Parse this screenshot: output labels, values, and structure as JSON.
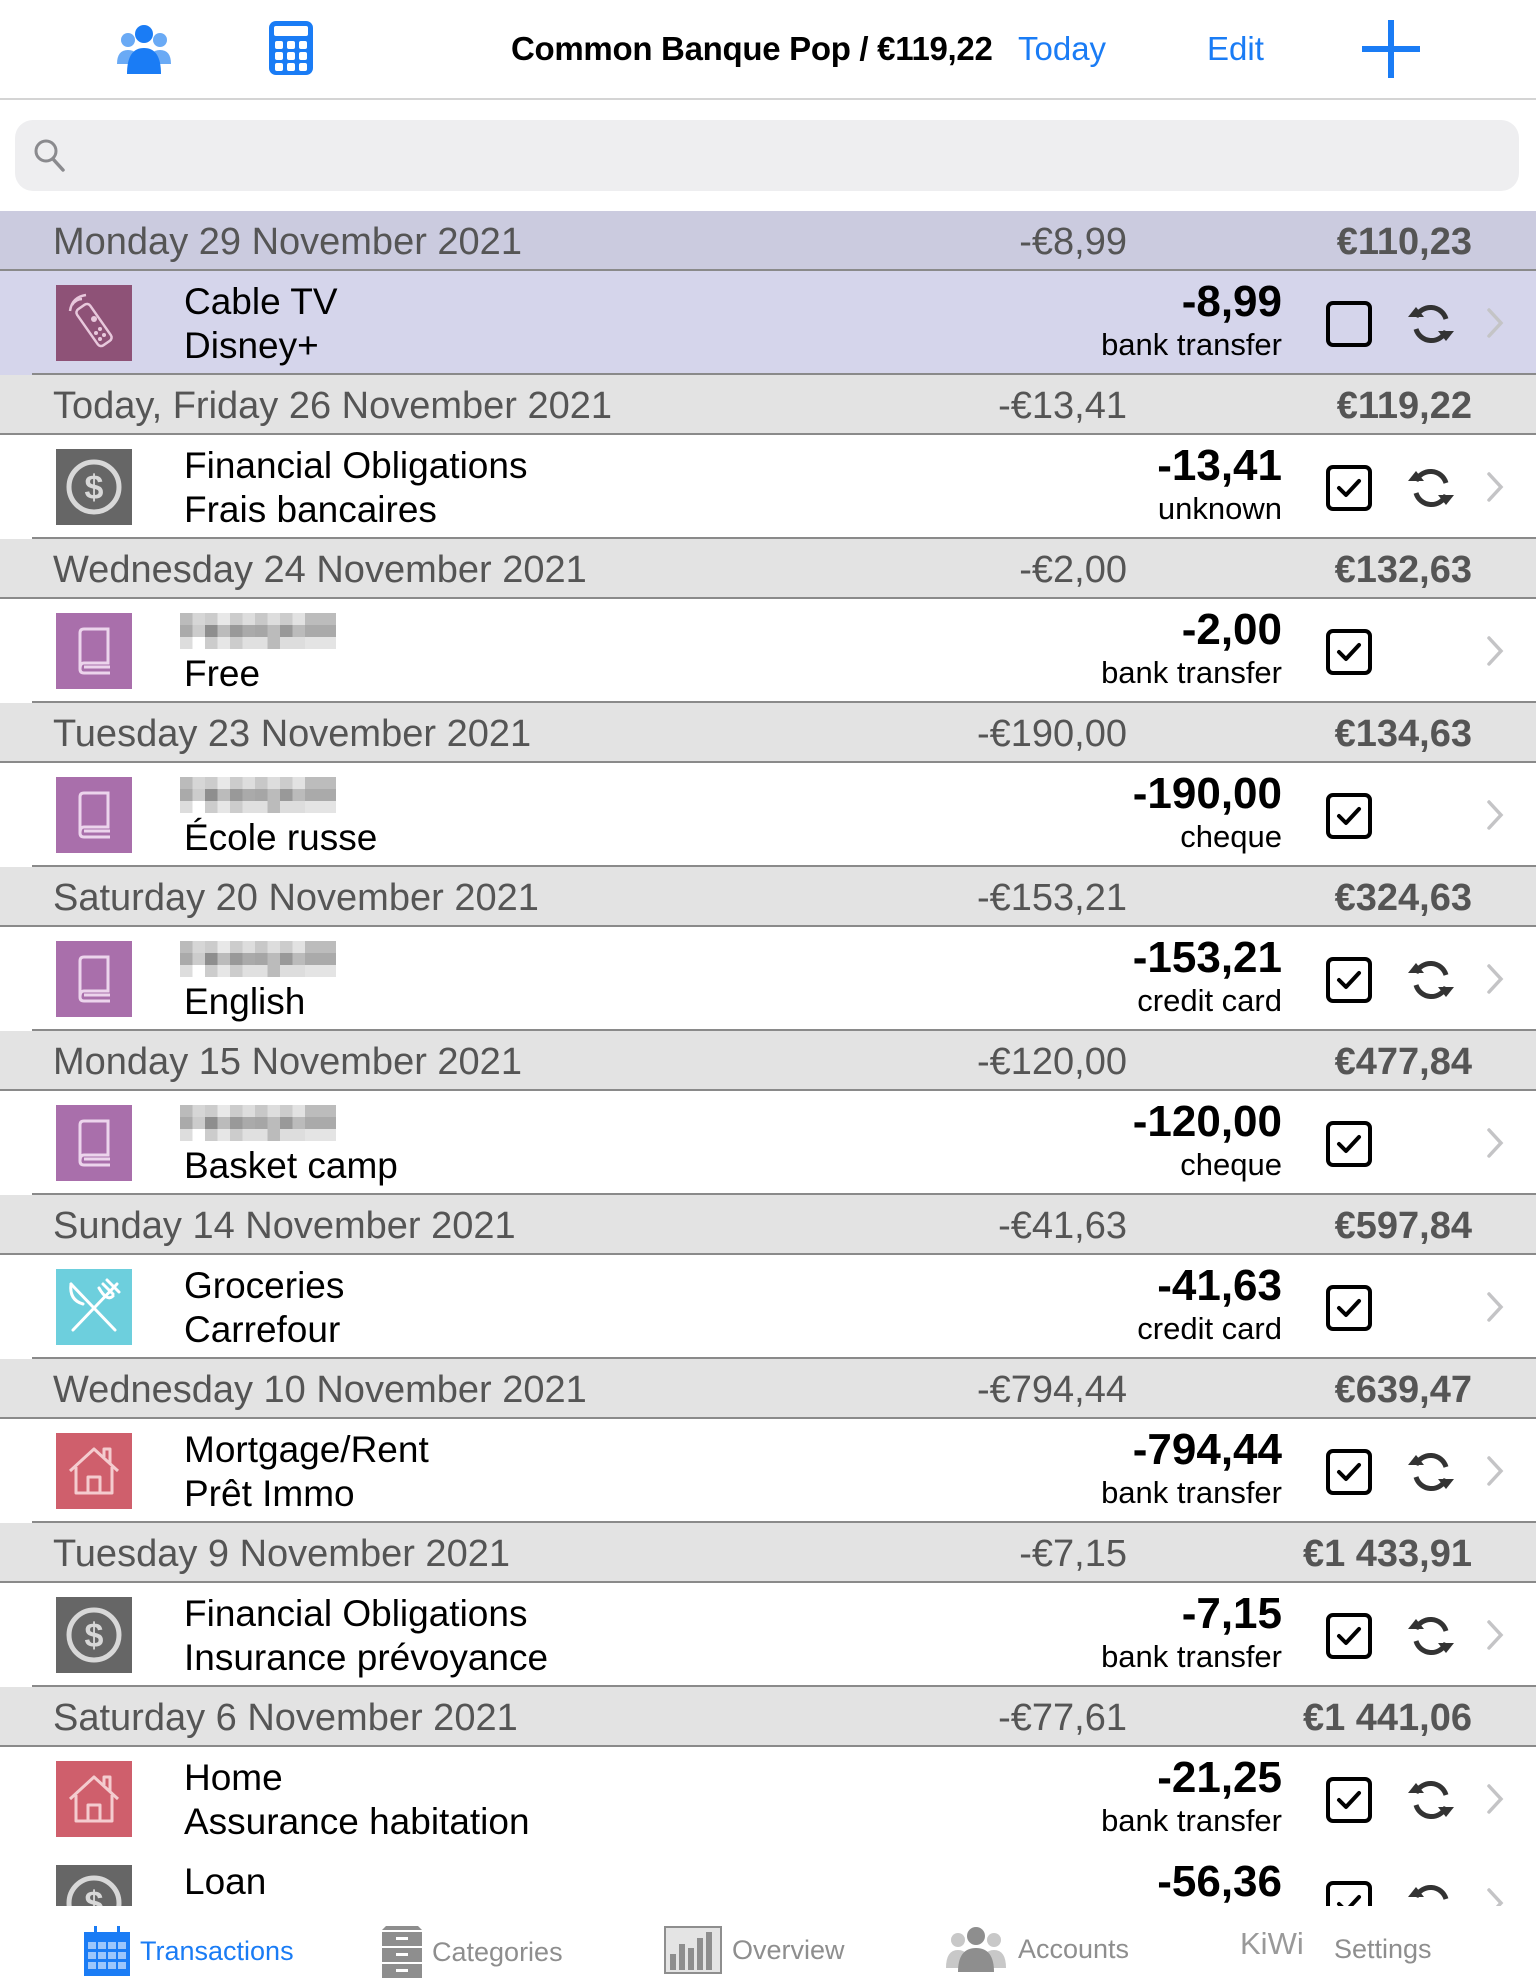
{
  "header": {
    "title": "Common Banque Pop / €119,22",
    "today_label": "Today",
    "edit_label": "Edit",
    "accent_color": "#1a7cf5"
  },
  "search": {
    "placeholder": ""
  },
  "sections": [
    {
      "date": "Monday 29 November 2021",
      "total": "-€8,99",
      "balance": "€110,23",
      "highlighted": true,
      "rows": [
        {
          "icon": "remote-control-icon",
          "icon_color": "#8e5277",
          "title": "Cable TV",
          "subtitle": "Disney+",
          "amount": "-8,99",
          "method": "bank transfer",
          "checked": false,
          "recurring": true
        }
      ]
    },
    {
      "date": "Today, Friday 26 November 2021",
      "total": "-€13,41",
      "balance": "€119,22",
      "rows": [
        {
          "icon": "dollar-coin-icon",
          "icon_color": "#666666",
          "title": "Financial Obligations",
          "subtitle": "Frais bancaires",
          "amount": "-13,41",
          "method": "unknown",
          "checked": true,
          "recurring": true
        }
      ]
    },
    {
      "date": "Wednesday 24 November 2021",
      "total": "-€2,00",
      "balance": "€132,63",
      "rows": [
        {
          "icon": "book-icon",
          "icon_color": "#a96fab",
          "title_blurred": true,
          "subtitle": "Free",
          "amount": "-2,00",
          "method": "bank transfer",
          "checked": true,
          "recurring": false
        }
      ]
    },
    {
      "date": "Tuesday 23 November 2021",
      "total": "-€190,00",
      "balance": "€134,63",
      "rows": [
        {
          "icon": "book-icon",
          "icon_color": "#a96fab",
          "title_blurred": true,
          "subtitle": "École russe",
          "amount": "-190,00",
          "method": "cheque",
          "checked": true,
          "recurring": false
        }
      ]
    },
    {
      "date": "Saturday 20 November 2021",
      "total": "-€153,21",
      "balance": "€324,63",
      "rows": [
        {
          "icon": "book-icon",
          "icon_color": "#a96fab",
          "title_blurred": true,
          "subtitle": "English",
          "amount": "-153,21",
          "method": "credit card",
          "checked": true,
          "recurring": true
        }
      ]
    },
    {
      "date": "Monday 15 November 2021",
      "total": "-€120,00",
      "balance": "€477,84",
      "rows": [
        {
          "icon": "book-icon",
          "icon_color": "#a96fab",
          "title_blurred": true,
          "subtitle": "Basket camp",
          "amount": "-120,00",
          "method": "cheque",
          "checked": true,
          "recurring": false
        }
      ]
    },
    {
      "date": "Sunday 14 November 2021",
      "total": "-€41,63",
      "balance": "€597,84",
      "rows": [
        {
          "icon": "fork-knife-icon",
          "icon_color": "#6dcfdd",
          "title": "Groceries",
          "subtitle": "Carrefour",
          "amount": "-41,63",
          "method": "credit card",
          "checked": true,
          "recurring": false
        }
      ]
    },
    {
      "date": "Wednesday 10 November 2021",
      "total": "-€794,44",
      "balance": "€639,47",
      "rows": [
        {
          "icon": "house-icon",
          "icon_color": "#cf5f6c",
          "title": "Mortgage/Rent",
          "subtitle": "Prêt Immo",
          "amount": "-794,44",
          "method": "bank transfer",
          "checked": true,
          "recurring": true
        }
      ]
    },
    {
      "date": "Tuesday 9 November 2021",
      "total": "-€7,15",
      "balance": "€1 433,91",
      "rows": [
        {
          "icon": "dollar-coin-icon",
          "icon_color": "#666666",
          "title": "Financial Obligations",
          "subtitle": "Insurance prévoyance",
          "amount": "-7,15",
          "method": "bank transfer",
          "checked": true,
          "recurring": true
        }
      ]
    },
    {
      "date": "Saturday 6 November 2021",
      "total": "-€77,61",
      "balance": "€1 441,06",
      "rows": [
        {
          "icon": "house-icon",
          "icon_color": "#cf5f6c",
          "title": "Home",
          "subtitle": "Assurance habitation",
          "amount": "-21,25",
          "method": "bank transfer",
          "checked": true,
          "recurring": true
        },
        {
          "icon": "dollar-coin-icon",
          "icon_color": "#666666",
          "title": "Loan",
          "amount": "-56,36",
          "checked": true,
          "recurring": true
        }
      ]
    }
  ],
  "tabbar": {
    "tabs": [
      {
        "label": "Transactions",
        "icon": "calendar-icon",
        "active": true
      },
      {
        "label": "Categories",
        "icon": "cabinet-icon"
      },
      {
        "label": "Overview",
        "icon": "bar-chart-icon"
      },
      {
        "label": "Accounts",
        "icon": "people-icon"
      },
      {
        "label": "Settings",
        "icon": "kiwi-logo"
      }
    ],
    "kiwi_text": "KiWi"
  }
}
